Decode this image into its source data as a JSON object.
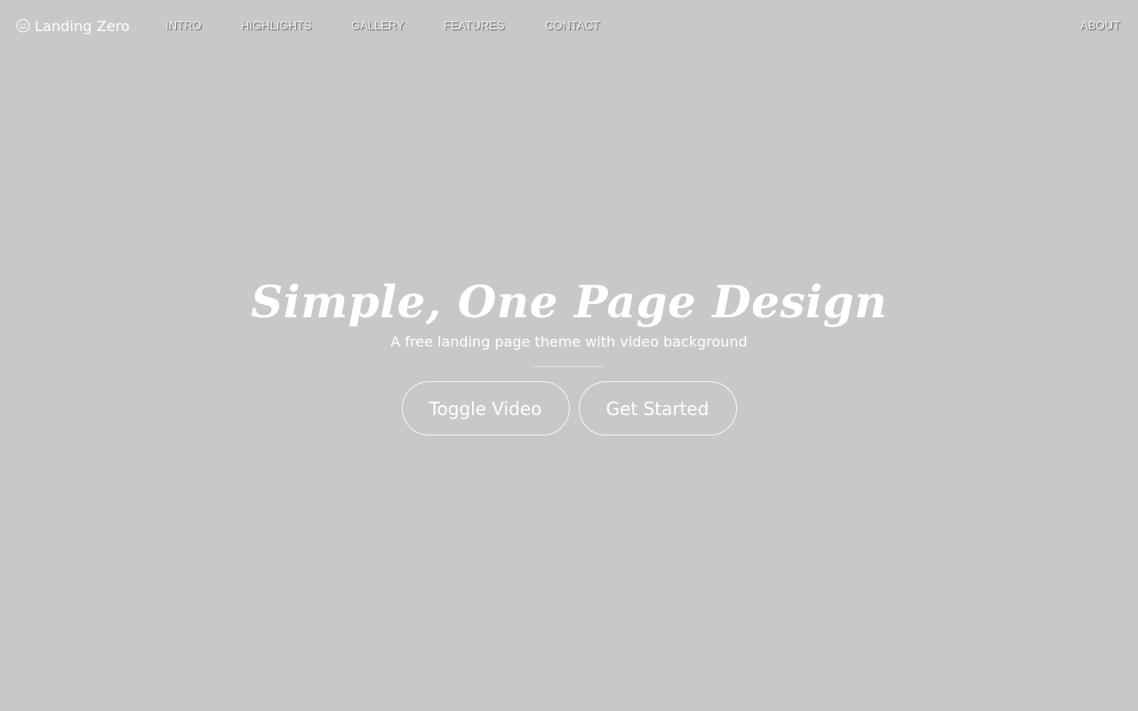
{
  "brand": {
    "label": "Landing Zero",
    "icon": "smile-circle-icon"
  },
  "nav": {
    "items": [
      {
        "label": "INTRO"
      },
      {
        "label": "HIGHLIGHTS"
      },
      {
        "label": "GALLERY"
      },
      {
        "label": "FEATURES"
      },
      {
        "label": "CONTACT"
      }
    ],
    "right_item": {
      "label": "ABOUT"
    }
  },
  "hero": {
    "title": "Simple, One Page Design",
    "subtitle": "A free landing page theme with video background",
    "buttons": {
      "toggle_video": "Toggle Video",
      "get_started": "Get Started"
    }
  },
  "colors": {
    "background": "#c8c8c8",
    "text": "#ffffff"
  }
}
